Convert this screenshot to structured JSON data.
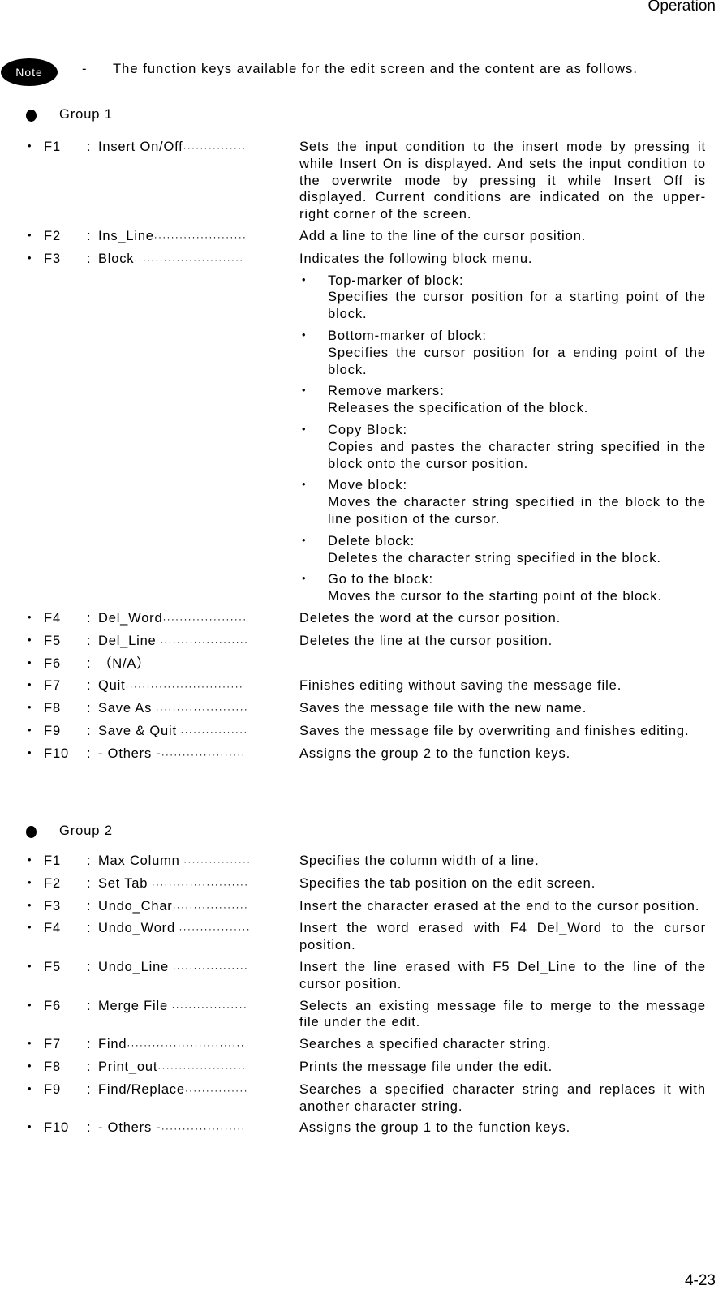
{
  "header": {
    "section": "Operation"
  },
  "note": {
    "badge": "Note",
    "dash": "-",
    "text": "The function keys available for the edit screen and the content are as follows."
  },
  "groups": [
    {
      "title": "Group 1",
      "keys": [
        {
          "key": "F1",
          "name": "Insert On/Off",
          "leader": "···············",
          "desc": "Sets the input condition to the insert mode by pressing it while Insert On is displayed. And sets the input condition to the overwrite mode by pressing it while Insert Off is displayed. Current conditions are indicated on the upper-right corner of the screen."
        },
        {
          "key": "F2",
          "name": "Ins_Line",
          "leader": "······················",
          "desc": "Add a line to the line of the cursor position."
        },
        {
          "key": "F3",
          "name": "Block",
          "leader": "··························",
          "desc": "Indicates the following block menu.",
          "submenu": [
            {
              "title": "Top-marker of block:",
              "text": "Specifies the cursor position for a starting point of the block."
            },
            {
              "title": "Bottom-marker of block:",
              "text": "Specifies the cursor position for a ending point of the block."
            },
            {
              "title": "Remove markers:",
              "text": "Releases the specification of the block."
            },
            {
              "title": "Copy Block:",
              "text": "Copies and pastes the character string specified in the block onto the cursor position."
            },
            {
              "title": "Move block:",
              "text": "Moves the character string specified in the block to the line position of the cursor."
            },
            {
              "title": "Delete block:",
              "text": "Deletes the character string specified in the block."
            },
            {
              "title": "Go to the block:",
              "text": "Moves the cursor to the starting point of the block."
            }
          ]
        },
        {
          "key": "F4",
          "name": "Del_Word",
          "leader": "····················",
          "desc": "Deletes the word at the cursor position."
        },
        {
          "key": "F5",
          "name": "Del_Line",
          "leader": " ·····················",
          "desc": "Deletes the line at the cursor position."
        },
        {
          "key": "F6",
          "name": "（N/A）",
          "leader": "",
          "desc": ""
        },
        {
          "key": "F7",
          "name": "Quit",
          "leader": "····························",
          "desc": "Finishes editing without saving the message file."
        },
        {
          "key": "F8",
          "name": "Save As",
          "leader": " ······················",
          "desc": "Saves the message file with the new name."
        },
        {
          "key": "F9",
          "name": "Save & Quit",
          "leader": " ················",
          "desc": "Saves the message file by overwriting and finishes editing."
        },
        {
          "key": "F10",
          "name": "- Others -",
          "leader": "····················",
          "desc": "Assigns the group 2 to the function keys."
        }
      ]
    },
    {
      "title": "Group 2",
      "keys": [
        {
          "key": "F1",
          "name": "Max Column",
          "leader": " ················",
          "desc": "Specifies the column width of a line."
        },
        {
          "key": "F2",
          "name": "Set Tab",
          "leader": " ·······················",
          "desc": "Specifies the tab position on the edit screen."
        },
        {
          "key": "F3",
          "name": "Undo_Char",
          "leader": "··················",
          "desc": "Insert the character erased at the end to the cursor position."
        },
        {
          "key": "F4",
          "name": "Undo_Word",
          "leader": " ·················",
          "desc": "Insert the word erased with F4 Del_Word to the cursor position."
        },
        {
          "key": "F5",
          "name": "Undo_Line",
          "leader": " ··················",
          "desc": "Insert the line erased with F5 Del_Line to the line of the cursor position."
        },
        {
          "key": "F6",
          "name": "Merge File",
          "leader": " ··················",
          "desc": "Selects an existing message file to merge to the message file under the edit."
        },
        {
          "key": "F7",
          "name": "Find",
          "leader": "····························",
          "desc": "Searches a specified character string."
        },
        {
          "key": "F8",
          "name": "Print_out",
          "leader": "·····················",
          "desc": "Prints the message file under the edit."
        },
        {
          "key": "F9",
          "name": "Find/Replace",
          "leader": "···············",
          "desc": "Searches a specified character string and replaces it with another character string."
        },
        {
          "key": "F10",
          "name": "- Others -",
          "leader": "····················",
          "desc": "Assigns the group 1 to the function keys."
        }
      ]
    }
  ],
  "footer": {
    "page_number": "4-23"
  }
}
